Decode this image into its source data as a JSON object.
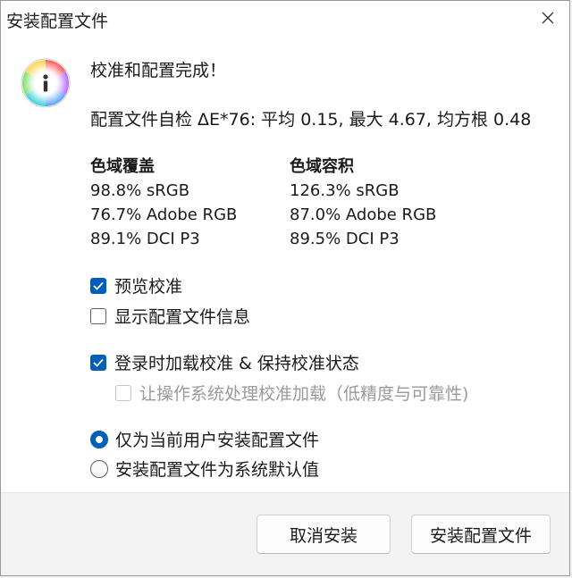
{
  "window": {
    "title": "安装配置文件"
  },
  "message": {
    "headline": "校准和配置完成！",
    "profile_check": "配置文件自检 ΔE*76: 平均 0.15, 最大 4.67, 均方根 0.48"
  },
  "gamut": {
    "coverage": {
      "heading": "色域覆盖",
      "rows": [
        "98.8% sRGB",
        "76.7% Adobe RGB",
        "89.1% DCI P3"
      ]
    },
    "volume": {
      "heading": "色域容积",
      "rows": [
        "126.3% sRGB",
        "87.0% Adobe RGB",
        "89.5% DCI P3"
      ]
    }
  },
  "options": {
    "preview_calibration": {
      "label": "预览校准",
      "checked": true
    },
    "show_profile_info": {
      "label": "显示配置文件信息",
      "checked": false
    },
    "load_on_login": {
      "label": "登录时加载校准 & 保持校准状态",
      "checked": true
    },
    "os_handles_loading": {
      "label": "让操作系统处理校准加载（低精度与可靠性)",
      "checked": false,
      "disabled": true
    }
  },
  "install_scope": {
    "current_user": {
      "label": "仅为当前用户安装配置文件",
      "selected": true
    },
    "system_default": {
      "label": "安装配置文件为系统默认值",
      "selected": false
    }
  },
  "buttons": {
    "cancel": "取消安装",
    "install": "安装配置文件"
  },
  "colors": {
    "accent": "#005fb8"
  },
  "icons": {
    "info": "info-icon",
    "close": "close-icon",
    "check": "checkmark-icon"
  }
}
